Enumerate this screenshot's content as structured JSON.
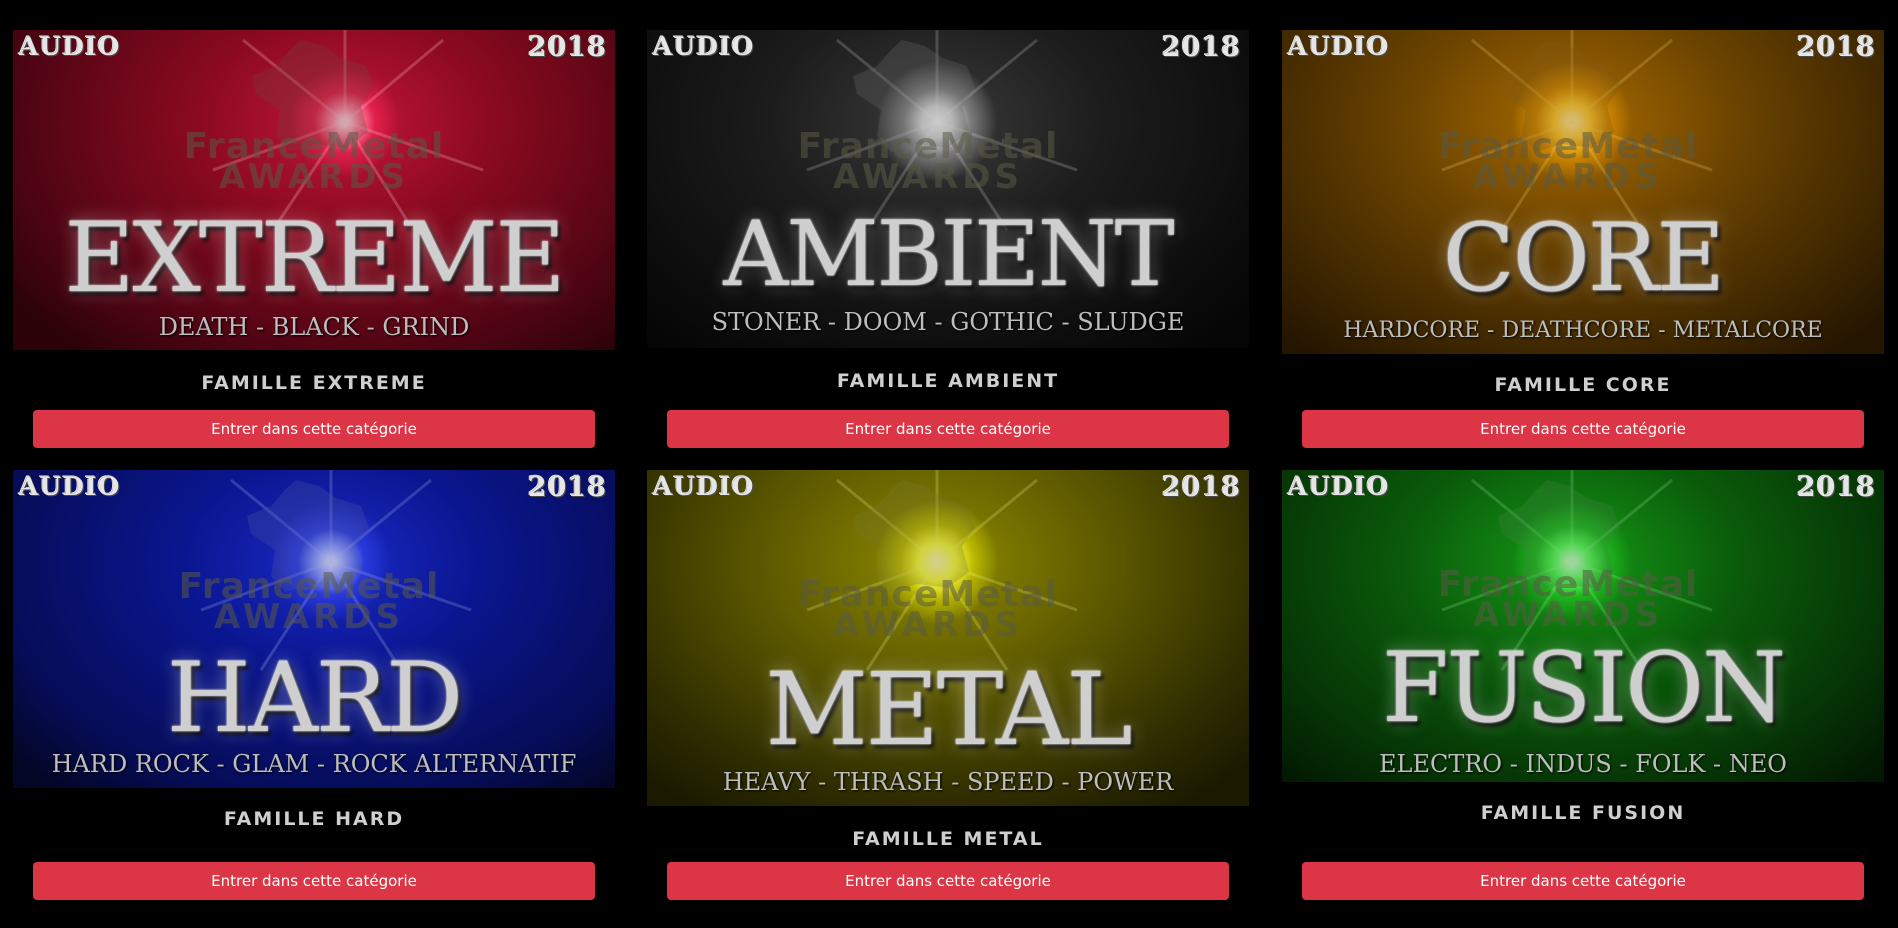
{
  "cards": [
    {
      "audio": "AUDIO",
      "year": "2018",
      "brand_line1": "FranceMetal",
      "brand_line2": "AWARDS",
      "genre": "EXTREME",
      "subgenres": "DEATH - BLACK - GRIND",
      "family": "FAMILLE EXTREME",
      "button": "Entrer dans cette catégorie",
      "color": "#8b0a1f"
    },
    {
      "audio": "AUDIO",
      "year": "2018",
      "brand_line1": "FranceMetal",
      "brand_line2": "AWARDS",
      "genre": "AMBIENT",
      "subgenres": "STONER - DOOM - GOTHIC - SLUDGE",
      "family": "FAMILLE AMBIENT",
      "button": "Entrer dans cette catégorie",
      "color": "#2a2a2a"
    },
    {
      "audio": "AUDIO",
      "year": "2018",
      "brand_line1": "FranceMetal",
      "brand_line2": "AWARDS",
      "genre": "CORE",
      "subgenres": "HARDCORE - DEATHCORE - METALCORE",
      "family": "FAMILLE CORE",
      "button": "Entrer dans cette catégorie",
      "color": "#7a4e00"
    },
    {
      "audio": "AUDIO",
      "year": "2018",
      "brand_line1": "FranceMetal",
      "brand_line2": "AWARDS",
      "genre": "HARD",
      "subgenres": "HARD ROCK - GLAM - ROCK ALTERNATIF",
      "family": "FAMILLE HARD",
      "button": "Entrer dans cette catégorie",
      "color": "#0a1690"
    },
    {
      "audio": "AUDIO",
      "year": "2018",
      "brand_line1": "FranceMetal",
      "brand_line2": "AWARDS",
      "genre": "METAL",
      "subgenres": "HEAVY - THRASH - SPEED - POWER",
      "family": "FAMILLE METAL",
      "button": "Entrer dans cette catégorie",
      "color": "#5e5a00"
    },
    {
      "audio": "AUDIO",
      "year": "2018",
      "brand_line1": "FranceMetal",
      "brand_line2": "AWARDS",
      "genre": "FUSION",
      "subgenres": "ELECTRO - INDUS - FOLK - NEO",
      "family": "FAMILLE FUSION",
      "button": "Entrer dans cette catégorie",
      "color": "#0a5a0a"
    }
  ]
}
